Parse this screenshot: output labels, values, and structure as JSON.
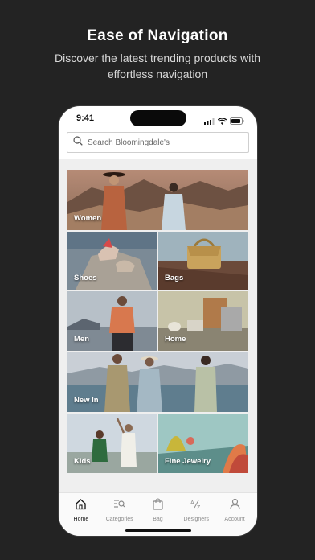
{
  "hero": {
    "title": "Ease of Navigation",
    "subtitle": "Discover the latest trending products with effortless navigation"
  },
  "status": {
    "time": "9:41"
  },
  "search": {
    "placeholder": "Search Bloomingdale's",
    "icon": "search-icon"
  },
  "categories": [
    {
      "label": "Women"
    },
    {
      "label": "Shoes"
    },
    {
      "label": "Bags"
    },
    {
      "label": "Men"
    },
    {
      "label": "Home"
    },
    {
      "label": "New In"
    },
    {
      "label": "Kids"
    },
    {
      "label": "Fine Jewelry"
    }
  ],
  "tabs": [
    {
      "label": "Home",
      "icon": "home-icon",
      "active": true
    },
    {
      "label": "Categories",
      "icon": "categories-icon",
      "active": false
    },
    {
      "label": "Bag",
      "icon": "bag-icon",
      "active": false
    },
    {
      "label": "Designers",
      "icon": "designers-icon",
      "active": false
    },
    {
      "label": "Account",
      "icon": "account-icon",
      "active": false
    }
  ],
  "colors": {
    "background": "#232323",
    "phone": "#ffffff",
    "active_tab": "#111111",
    "inactive_tab": "#8a8a8a"
  }
}
